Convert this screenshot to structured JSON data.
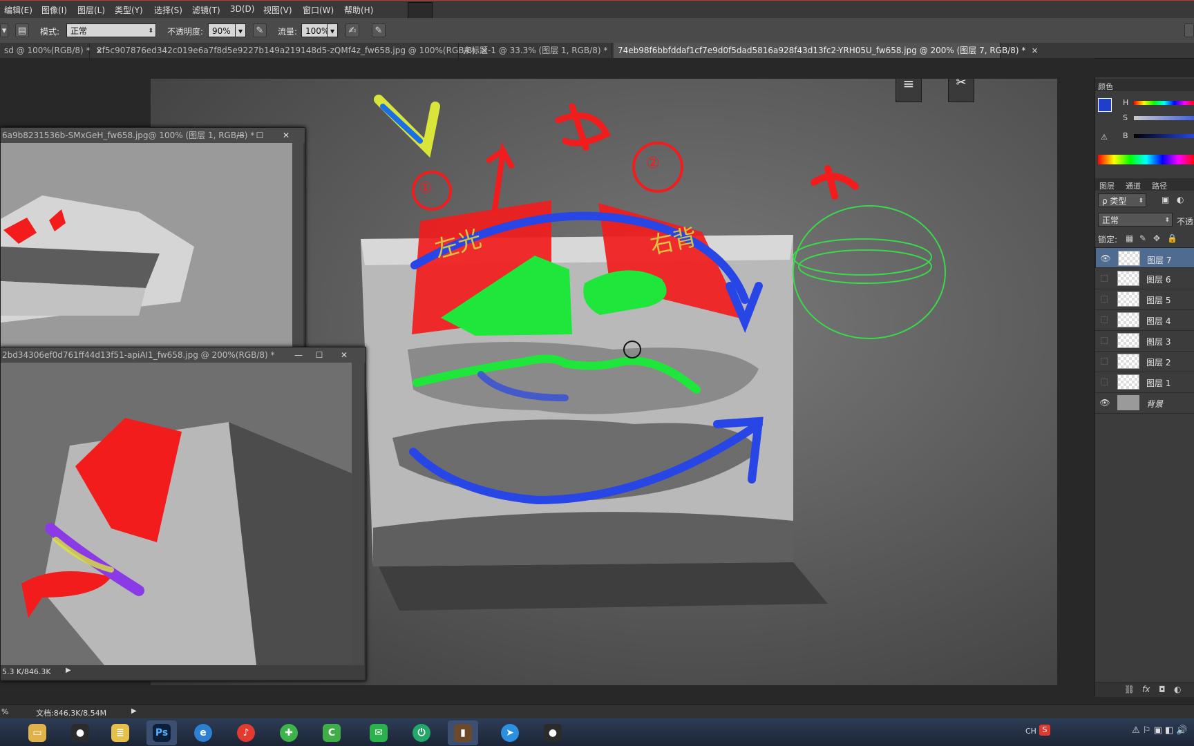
{
  "menu": [
    "编辑(E)",
    "图像(I)",
    "图层(L)",
    "类型(Y)",
    "选择(S)",
    "滤镜(T)",
    "3D(D)",
    "视图(V)",
    "窗口(W)",
    "帮助(H)"
  ],
  "options": {
    "mode_label": "模式:",
    "mode_value": "正常",
    "opacity_label": "不透明度:",
    "opacity_value": "90%",
    "flow_label": "流量:",
    "flow_value": "100%"
  },
  "tabs": [
    {
      "label": "sd @ 100%(RGB/8) *",
      "close": "×"
    },
    {
      "label": "2f5c907876ed342c019e6a7f8d5e9227b149a219148d5-zQMf4z_fw658.jpg @ 100%(RGB/8)",
      "close": "×"
    },
    {
      "label": "未标题-1 @ 33.3% (图层 1, RGB/8) *",
      "close": "×"
    },
    {
      "label": "74eb98f6bbfddaf1cf7e9d0f5dad5816a928f43d13fc2-YRH05U_fw658.jpg @ 200% (图层 7, RGB/8) *",
      "close": "×"
    }
  ],
  "doc_windows": [
    {
      "title": "6a9b8231536b-SMxGeH_fw658.jpg@ 100% (图层 1, RGB/8) *"
    },
    {
      "title": "2bd34306ef0d761ff44d13f51-apiAI1_fw658.jpg @ 200%(RGB/8) *",
      "status": "5.3 K/846.3K"
    }
  ],
  "canvas_annotations": [
    "①",
    "②",
    "左光",
    "右背"
  ],
  "color_panel": {
    "title": "颜色",
    "channels": [
      "H",
      "S",
      "B"
    ],
    "foreground": "#1f3ec9",
    "background": "#ffffff"
  },
  "layers_panel": {
    "tabs": [
      "图层",
      "通道",
      "路径"
    ],
    "filter_label": "ρ 类型",
    "blend_mode": "正常",
    "opacity_label": "不透",
    "lock_label": "锁定:",
    "layers": [
      {
        "name": "图层 7",
        "visible": true,
        "selected": true
      },
      {
        "name": "图层 6",
        "visible": false,
        "selected": false
      },
      {
        "name": "图层 5",
        "visible": false,
        "selected": false
      },
      {
        "name": "图层 4",
        "visible": false,
        "selected": false
      },
      {
        "name": "图层 3",
        "visible": false,
        "selected": false
      },
      {
        "name": "图层 2",
        "visible": false,
        "selected": false
      },
      {
        "name": "图层 1",
        "visible": false,
        "selected": false
      },
      {
        "name": "背景",
        "visible": true,
        "selected": false
      }
    ],
    "footer_fx": "fx"
  },
  "statusbar": {
    "left": "%",
    "doc": "文档:846.3K/8.54M"
  },
  "taskbar": {
    "lang": "CH",
    "apps": [
      "explorer",
      "qq",
      "notepad",
      "photoshop",
      "browser",
      "netease-music",
      "360",
      "camtasia",
      "wechat",
      "app-green",
      "video",
      "feishu",
      "qq-2"
    ]
  }
}
